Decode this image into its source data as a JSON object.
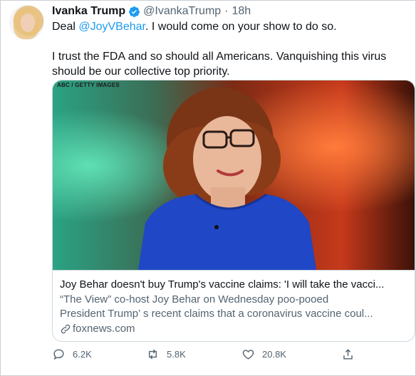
{
  "tweet": {
    "author_name": "Ivanka Trump",
    "handle": "@IvankaTrump",
    "separator": "·",
    "time": "18h",
    "verified": true,
    "text_line1_prefix": "Deal ",
    "mention": "@JoyVBehar",
    "text_line1_suffix": ". I would come on your show to do so.",
    "text_para2": "I trust the FDA and so should all Americans. Vanquishing this virus should be our collective top priority."
  },
  "card": {
    "image_credit": "ABC / GETTY IMAGES",
    "title": "Joy Behar doesn't buy Trump's vaccine claims: 'I will take the vacci...",
    "desc_line1": "“The View”  co-host Joy Behar on Wednesday poo-pooed",
    "desc_line2": "President Trump’ s recent claims that a coronavirus vaccine coul...",
    "domain": "foxnews.com"
  },
  "actions": {
    "reply_count": "6.2K",
    "retweet_count": "5.8K",
    "like_count": "20.8K"
  },
  "icons": {
    "verified": "verified-badge-icon",
    "reply": "reply-icon",
    "retweet": "retweet-icon",
    "like": "heart-icon",
    "share": "share-icon",
    "link": "link-icon"
  },
  "colors": {
    "accent": "#1d9bf0",
    "text": "#0f1419",
    "secondary": "#536471",
    "border": "#cfd9de"
  }
}
